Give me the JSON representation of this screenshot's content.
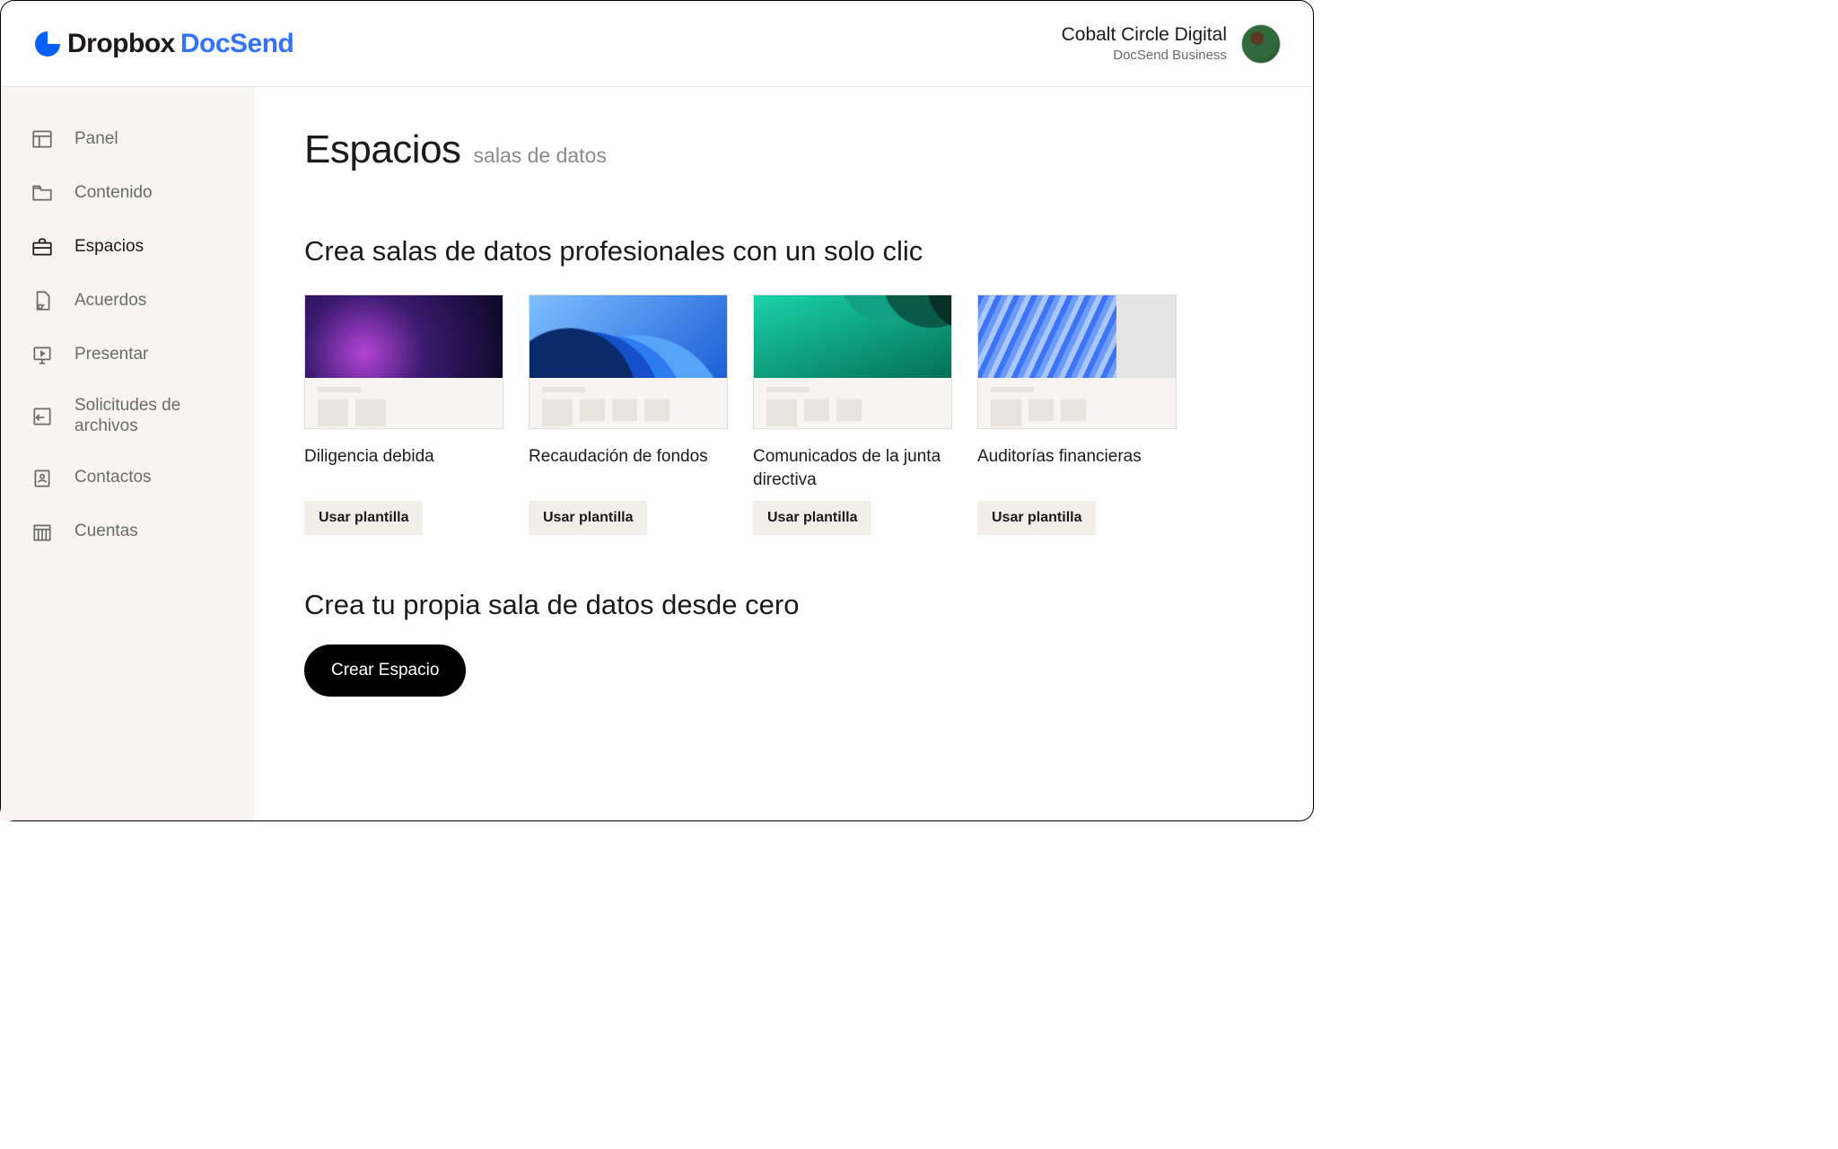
{
  "header": {
    "brand_primary": "Dropbox",
    "brand_secondary": "DocSend",
    "org_name": "Cobalt Circle Digital",
    "plan_name": "DocSend Business"
  },
  "sidebar": {
    "items": [
      {
        "label": "Panel",
        "icon": "dashboard-icon"
      },
      {
        "label": "Contenido",
        "icon": "folder-icon"
      },
      {
        "label": "Espacios",
        "icon": "briefcase-icon",
        "active": true
      },
      {
        "label": "Acuerdos",
        "icon": "agreement-icon"
      },
      {
        "label": "Presentar",
        "icon": "present-icon"
      },
      {
        "label": "Solicitudes de archivos",
        "icon": "file-request-icon"
      },
      {
        "label": "Contactos",
        "icon": "contacts-icon"
      },
      {
        "label": "Cuentas",
        "icon": "accounts-icon"
      }
    ]
  },
  "main": {
    "page_title": "Espacios",
    "page_subtitle": "salas de datos",
    "templates_heading": "Crea salas de datos profesionales con un solo clic",
    "use_template_label": "Usar plantilla",
    "templates": [
      {
        "title": "Diligencia debida",
        "thumb": "purple",
        "blocks": [
          34,
          34
        ]
      },
      {
        "title": "Recaudación de fondos",
        "thumb": "blue",
        "blocks": [
          34,
          28,
          28,
          28
        ]
      },
      {
        "title": "Comunicados de la junta directiva",
        "thumb": "green",
        "blocks": [
          34,
          28,
          28
        ]
      },
      {
        "title": "Auditorías financieras",
        "thumb": "lightblue",
        "blocks": [
          34,
          28,
          28
        ]
      }
    ],
    "create_heading": "Crea tu propia sala de datos desde cero",
    "create_button": "Crear Espacio"
  }
}
